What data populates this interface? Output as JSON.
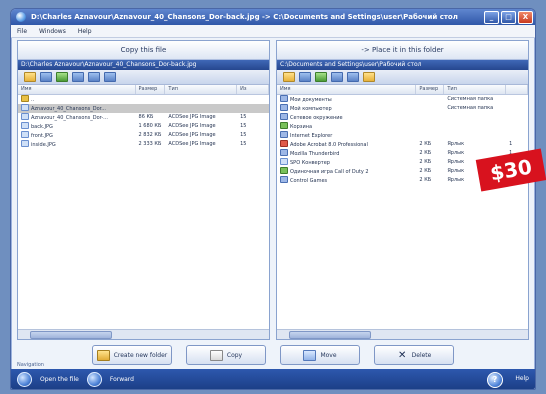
{
  "window": {
    "title": "D:\\Charles Aznavour\\Aznavour_40_Chansons_Dor-back.jpg -> C:\\Documents and Settings\\user\\Рабочий стол",
    "controls": [
      "_",
      "□",
      "X"
    ]
  },
  "menu": [
    "File",
    "Windows",
    "Help"
  ],
  "left_pane": {
    "header": "Copy this file",
    "path": "D:\\Charles Aznavour\\Aznavour_40_Chansons_Dor-back.jpg",
    "columns": [
      "Имя",
      "Размер",
      "Тип",
      "Из"
    ],
    "rows": [
      {
        "name": "..",
        "size": "",
        "type": "",
        "extra": ""
      },
      {
        "name": "Aznavour_40_Chansons_Dor...",
        "size": "",
        "type": "",
        "extra": ""
      },
      {
        "name": "Aznavour_40_Chansons_Dor-...",
        "size": "86 КБ",
        "type": "ACDSee JPG Image",
        "extra": "15"
      },
      {
        "name": "back.JPG",
        "size": "1 680 КБ",
        "type": "ACDSee JPG Image",
        "extra": "15"
      },
      {
        "name": "front.JPG",
        "size": "2 832 КБ",
        "type": "ACDSee JPG Image",
        "extra": "15"
      },
      {
        "name": "inside.JPG",
        "size": "2 333 КБ",
        "type": "ACDSee JPG Image",
        "extra": "15"
      }
    ]
  },
  "right_pane": {
    "header": "-> Place it in this folder",
    "path": "C:\\Documents and Settings\\user\\Рабочий стол",
    "columns": [
      "Имя",
      "Размер",
      "Тип",
      ""
    ],
    "rows": [
      {
        "name": "Мои документы",
        "size": "",
        "type": "Системная папка",
        "extra": ""
      },
      {
        "name": "Мой компьютер",
        "size": "",
        "type": "Системная папка",
        "extra": ""
      },
      {
        "name": "Сетевое окружение",
        "size": "",
        "type": "",
        "extra": ""
      },
      {
        "name": "Корзина",
        "size": "",
        "type": "",
        "extra": ""
      },
      {
        "name": "Internet Explorer",
        "size": "",
        "type": "",
        "extra": ""
      },
      {
        "name": "Adobe Acrobat 8.0 Professional",
        "size": "2 КБ",
        "type": "Ярлык",
        "extra": "1"
      },
      {
        "name": "Mozilla Thunderbird",
        "size": "2 КБ",
        "type": "Ярлык",
        "extra": "1"
      },
      {
        "name": "SPO Конвертер",
        "size": "2 КБ",
        "type": "Ярлык",
        "extra": "2"
      },
      {
        "name": "Одиночная игра Call of Duty 2",
        "size": "2 КБ",
        "type": "Ярлык",
        "extra": "2"
      },
      {
        "name": "Control Games",
        "size": "2 КБ",
        "type": "Ярлык",
        "extra": "2"
      }
    ]
  },
  "actions": {
    "new_folder": "Create new folder",
    "copy": "Copy",
    "move": "Move",
    "delete": "Delete"
  },
  "bottom": {
    "label": "Navigation",
    "back": "Open the file",
    "forward": "Forward",
    "help": "?",
    "help_label": "Help"
  },
  "badge": "$30"
}
